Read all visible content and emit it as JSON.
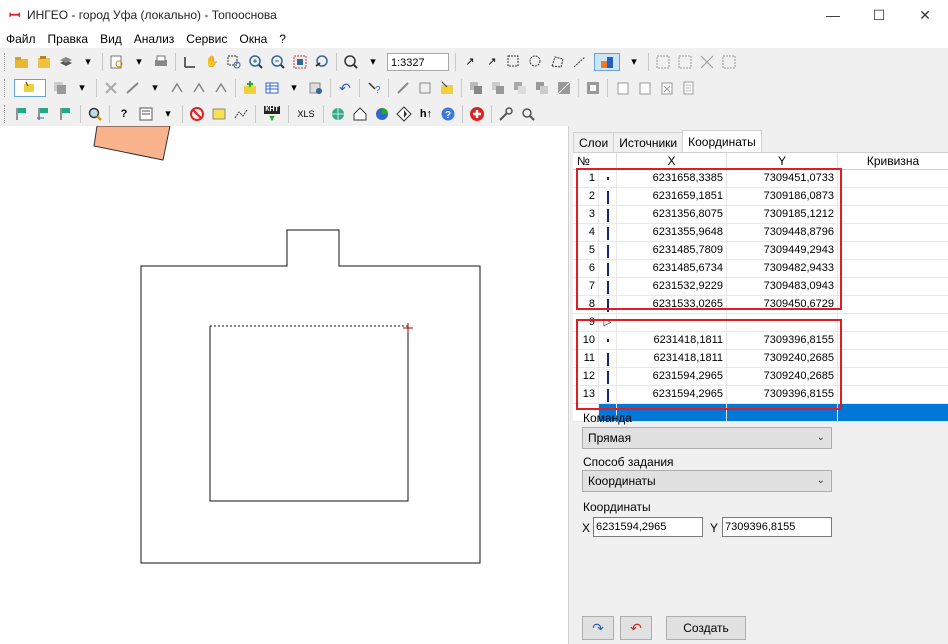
{
  "window": {
    "title": "ИНГЕО - город Уфа (локально) - Топооснова"
  },
  "menu": [
    "Файл",
    "Правка",
    "Вид",
    "Анализ",
    "Сервис",
    "Окна",
    "?"
  ],
  "toolbar": {
    "scale": "1:3327",
    "xls_label": "XLS",
    "knt_label": "КНТ"
  },
  "tabs": [
    "Слои",
    "Источники",
    "Координаты"
  ],
  "grid": {
    "headers": [
      "№",
      "X",
      "Y",
      "Кривизна"
    ],
    "rows": [
      {
        "n": "1",
        "x": "6231658,3385",
        "y": "7309451,0733",
        "mark": "dot"
      },
      {
        "n": "2",
        "x": "6231659,1851",
        "y": "7309186,0873",
        "mark": "bar"
      },
      {
        "n": "3",
        "x": "6231356,8075",
        "y": "7309185,1212",
        "mark": "bar"
      },
      {
        "n": "4",
        "x": "6231355,9648",
        "y": "7309448,8796",
        "mark": "bar"
      },
      {
        "n": "5",
        "x": "6231485,7809",
        "y": "7309449,2943",
        "mark": "bar"
      },
      {
        "n": "6",
        "x": "6231485,6734",
        "y": "7309482,9433",
        "mark": "bar"
      },
      {
        "n": "7",
        "x": "6231532,9229",
        "y": "7309483,0943",
        "mark": "bar"
      },
      {
        "n": "8",
        "x": "6231533,0265",
        "y": "7309450,6729",
        "mark": "bar"
      },
      {
        "n": "9",
        "x": "",
        "y": "",
        "mark": "play"
      },
      {
        "n": "10",
        "x": "6231418,1811",
        "y": "7309396,8155",
        "mark": "dot"
      },
      {
        "n": "11",
        "x": "6231418,1811",
        "y": "7309240,2685",
        "mark": "bar"
      },
      {
        "n": "12",
        "x": "6231594,2965",
        "y": "7309240,2685",
        "mark": "bar"
      },
      {
        "n": "13",
        "x": "6231594,2965",
        "y": "7309396,8155",
        "mark": "bar"
      }
    ]
  },
  "command": {
    "label": "Команда",
    "value": "Прямая"
  },
  "method": {
    "label": "Способ задания",
    "value": "Координаты"
  },
  "coords": {
    "label": "Координаты",
    "x_label": "X",
    "x_value": "6231594,2965",
    "y_label": "Y",
    "y_value": "7309396,8155"
  },
  "buttons": {
    "create": "Создать"
  },
  "colors": {
    "highlight": "#e31b23",
    "selection": "#0078d7",
    "parcel": "#f9b38d"
  }
}
